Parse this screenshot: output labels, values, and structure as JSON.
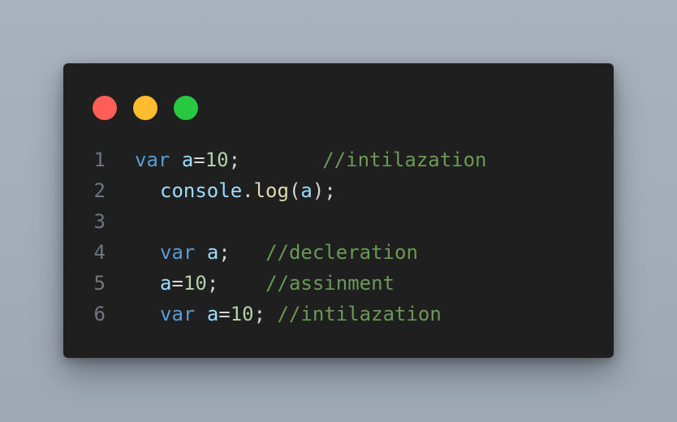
{
  "window": {
    "dots": [
      {
        "name": "close",
        "color": "#ff5f57"
      },
      {
        "name": "minimize",
        "color": "#febc2e"
      },
      {
        "name": "maximize",
        "color": "#28c840"
      }
    ]
  },
  "code": {
    "lines": [
      {
        "number": "1",
        "indent": false,
        "tokens": [
          {
            "t": "kw",
            "v": "var"
          },
          {
            "t": "pl",
            "v": " "
          },
          {
            "t": "id",
            "v": "a"
          },
          {
            "t": "pl",
            "v": "="
          },
          {
            "t": "num",
            "v": "10"
          },
          {
            "t": "pl",
            "v": ";       "
          },
          {
            "t": "cm",
            "v": "//intilazation"
          }
        ]
      },
      {
        "number": "2",
        "indent": true,
        "tokens": [
          {
            "t": "id",
            "v": "console"
          },
          {
            "t": "pl",
            "v": "."
          },
          {
            "t": "fn",
            "v": "log"
          },
          {
            "t": "pl",
            "v": "("
          },
          {
            "t": "id",
            "v": "a"
          },
          {
            "t": "pl",
            "v": ");"
          }
        ]
      },
      {
        "number": "3",
        "indent": true,
        "tokens": []
      },
      {
        "number": "4",
        "indent": true,
        "tokens": [
          {
            "t": "kw",
            "v": "var"
          },
          {
            "t": "pl",
            "v": " "
          },
          {
            "t": "id",
            "v": "a"
          },
          {
            "t": "pl",
            "v": ";   "
          },
          {
            "t": "cm",
            "v": "//decleration"
          }
        ]
      },
      {
        "number": "5",
        "indent": true,
        "tokens": [
          {
            "t": "id",
            "v": "a"
          },
          {
            "t": "pl",
            "v": "="
          },
          {
            "t": "num",
            "v": "10"
          },
          {
            "t": "pl",
            "v": ";    "
          },
          {
            "t": "cm",
            "v": "//assinment"
          }
        ]
      },
      {
        "number": "6",
        "indent": true,
        "tokens": [
          {
            "t": "kw",
            "v": "var"
          },
          {
            "t": "pl",
            "v": " "
          },
          {
            "t": "id",
            "v": "a"
          },
          {
            "t": "pl",
            "v": "="
          },
          {
            "t": "num",
            "v": "10"
          },
          {
            "t": "pl",
            "v": "; "
          },
          {
            "t": "cm",
            "v": "//intilazation"
          }
        ]
      }
    ]
  }
}
